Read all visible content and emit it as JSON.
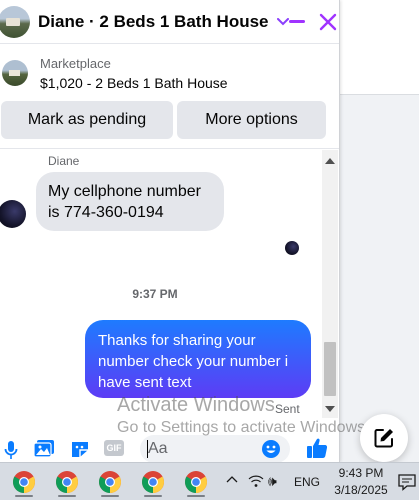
{
  "chat": {
    "title": "Diane · 2 Beds 1 Bath House",
    "listing": {
      "label": "Marketplace",
      "title": "$1,020 - 2 Beds 1 Bath House"
    },
    "actions": {
      "mark_pending": "Mark as pending",
      "more_options": "More options"
    },
    "messages": {
      "sender_name": "Diane",
      "incoming_text": "My cellphone number is 774-360-0194",
      "timestamp": "9:37 PM",
      "outgoing_text": "Thanks for sharing your number check your number i have sent text",
      "status": "Sent"
    },
    "composer": {
      "placeholder": "Aa",
      "gif_label": "GIF"
    }
  },
  "watermark": {
    "title": "Activate Windows",
    "subtitle": "Go to Settings to activate Windows."
  },
  "taskbar": {
    "language": "ENG",
    "time": "9:43 PM",
    "date": "3/18/2025"
  },
  "colors": {
    "accent": "#a033ff",
    "bubble_gradient_top": "#1e7bff",
    "bubble_gradient_bottom": "#5d3cf5",
    "icon_blue": "#0a7cff"
  },
  "icons": [
    "chevron-down-icon",
    "minimize-icon",
    "close-icon",
    "microphone-icon",
    "photo-icon",
    "sticker-icon",
    "gif-icon",
    "emoji-icon",
    "like-icon",
    "compose-icon",
    "chrome-icon",
    "network-icon",
    "volume-icon",
    "notification-icon"
  ]
}
